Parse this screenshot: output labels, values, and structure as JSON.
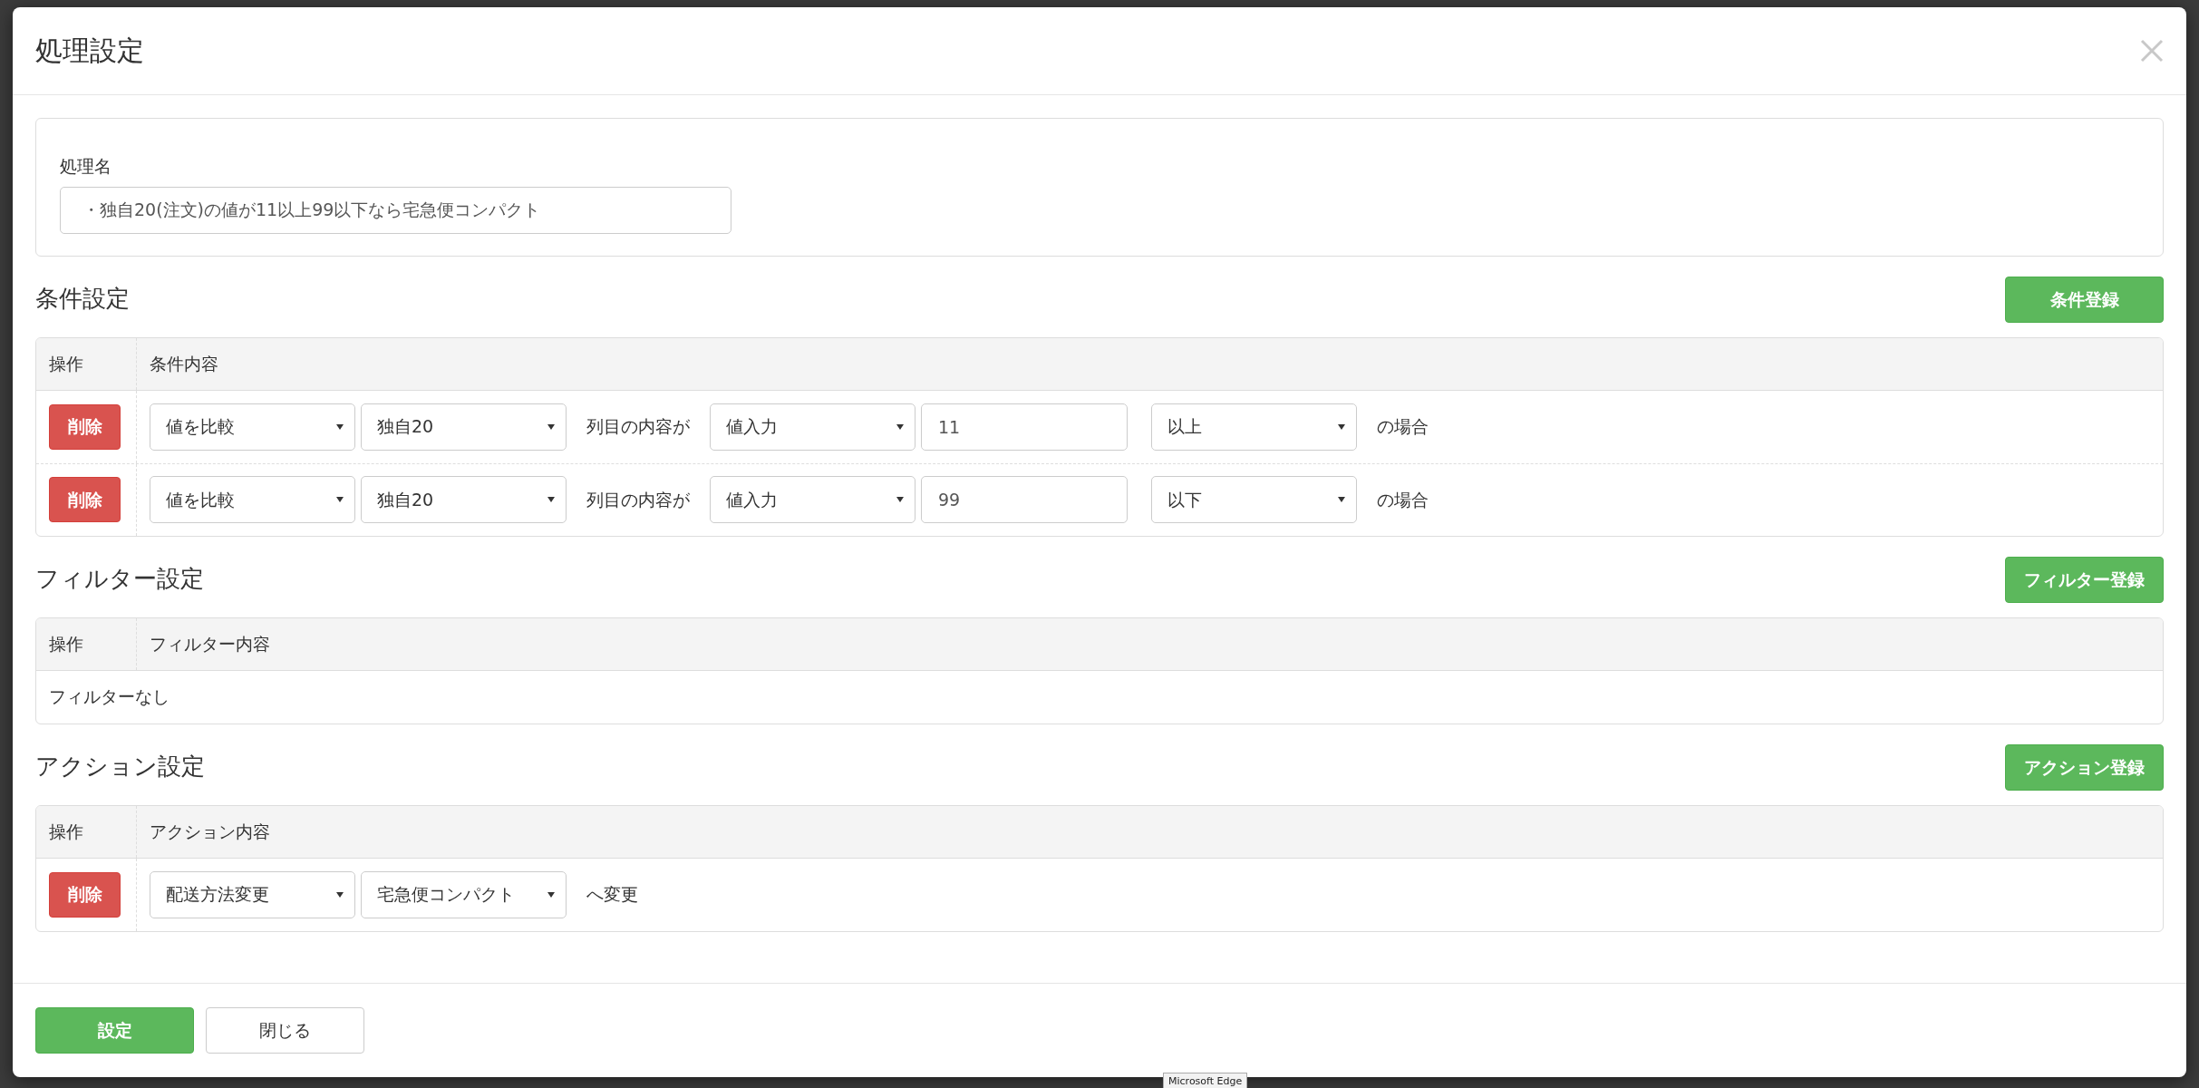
{
  "dialog": {
    "title": "処理設定"
  },
  "name_field": {
    "label": "処理名",
    "value": "・独自20(注文)の値が11以上99以下なら宅急便コンパクト"
  },
  "sections": [
    {
      "title": "条件設定",
      "register_button": "条件登録",
      "columns": [
        "操作",
        "条件内容"
      ],
      "rows": [
        {
          "delete_button": "削除",
          "parts": [
            {
              "kind": "select",
              "value": "値を比較"
            },
            {
              "kind": "select",
              "value": "独自20"
            },
            {
              "kind": "text",
              "value": "列目の内容が"
            },
            {
              "kind": "select",
              "value": "値入力"
            },
            {
              "kind": "input",
              "value": "11"
            },
            {
              "kind": "select",
              "value": "以上"
            },
            {
              "kind": "text",
              "value": "の場合"
            }
          ]
        },
        {
          "delete_button": "削除",
          "parts": [
            {
              "kind": "select",
              "value": "値を比較"
            },
            {
              "kind": "select",
              "value": "独自20"
            },
            {
              "kind": "text",
              "value": "列目の内容が"
            },
            {
              "kind": "select",
              "value": "値入力"
            },
            {
              "kind": "input",
              "value": "99"
            },
            {
              "kind": "select",
              "value": "以下"
            },
            {
              "kind": "text",
              "value": "の場合"
            }
          ]
        }
      ]
    },
    {
      "title": "フィルター設定",
      "register_button": "フィルター登録",
      "columns": [
        "操作",
        "フィルター内容"
      ],
      "empty_text": "フィルターなし"
    },
    {
      "title": "アクション設定",
      "register_button": "アクション登録",
      "columns": [
        "操作",
        "アクション内容"
      ],
      "rows": [
        {
          "delete_button": "削除",
          "parts": [
            {
              "kind": "select",
              "value": "配送方法変更"
            },
            {
              "kind": "select",
              "value": "宅急便コンパクト"
            },
            {
              "kind": "text",
              "value": "へ変更"
            }
          ]
        }
      ]
    }
  ],
  "footer_buttons": [
    {
      "label": "設定",
      "kind": "primary"
    },
    {
      "label": "閉じる",
      "kind": "default"
    }
  ],
  "tooltip": {
    "text": "Microsoft Edge"
  }
}
